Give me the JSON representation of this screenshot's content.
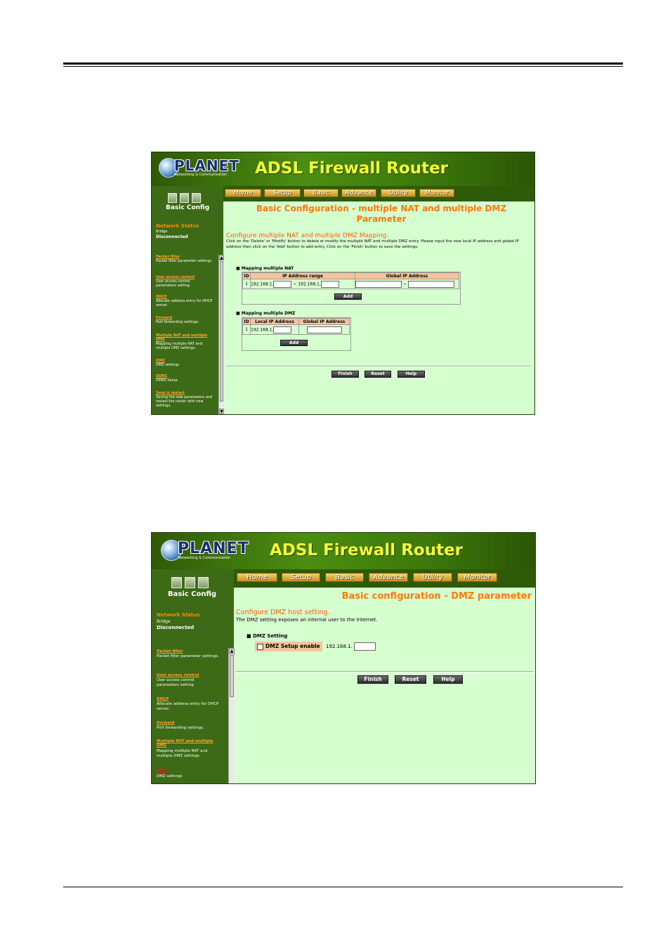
{
  "screen1": {
    "logo": {
      "brand": "PLANET",
      "tagline": "Networking & Communication"
    },
    "title": "ADSL  Firewall Router",
    "nav": [
      "Home",
      "Setup",
      "Basic",
      "Advance",
      "Utility",
      "Monitor"
    ],
    "sidebar": {
      "heading": "Basic Config",
      "network_status_label": "Network Status",
      "mode": "Bridge",
      "status": "Disconnected",
      "items": [
        {
          "label": "Packet filter",
          "desc": "Packet filter parameter settings."
        },
        {
          "label": "User access control",
          "desc": "User access control parameters setting"
        },
        {
          "label": "DHCP",
          "desc": "Allocate address entry for DHCP server."
        },
        {
          "label": "Forward",
          "desc": "Port forwarding settings."
        },
        {
          "label": "Multiple NAT and multiple DMZ",
          "desc": "Mapping multiple NAT and multiple DMZ settings."
        },
        {
          "label": "DMZ",
          "desc": "DMZ settings"
        },
        {
          "label": "DDNS",
          "desc": "DDNS Setup"
        },
        {
          "label": "Save & restart",
          "desc": "Saving the new parameters and restart the router with new settings."
        }
      ]
    },
    "page_title": "Basic Configuration - multiple NAT and multiple DMZ Parameter",
    "section_heading": "Configure multiple NAT and multiple DMZ Mapping.",
    "description": "Click on the 'Delete' or 'Modify' button to delete or modify the multiple NAT and multiple DMZ entry. Please input the new local IP address and global IP address then click on the 'Add' button to add entry. Click on the 'Finish' button to save the settings.",
    "nat": {
      "label": "Mapping multiple NAT",
      "headers": [
        "ID",
        "IP Address range",
        "Global IP Address"
      ],
      "row_id": "1",
      "prefix1": "192.168.1.",
      "tilde": "~",
      "prefix2": "192.168.1.",
      "add": "Add"
    },
    "dmz": {
      "label": "Mapping multiple DMZ",
      "headers": [
        "ID",
        "Local IP Address",
        "Global IP Address"
      ],
      "row_id": "1",
      "prefix": "192.168.1.",
      "add": "Add"
    },
    "buttons": {
      "finish": "Finish",
      "reset": "Reset",
      "help": "Help"
    }
  },
  "screen2": {
    "logo": {
      "brand": "PLANET",
      "tagline": "Networking & Communication"
    },
    "title": "ADSL  Firewall Router",
    "nav": [
      "Home",
      "Setup",
      "Basic",
      "Advance",
      "Utility",
      "Monitor"
    ],
    "sidebar": {
      "heading": "Basic Config",
      "network_status_label": "Network Status",
      "mode": "Bridge",
      "status": "Disconnected",
      "items": [
        {
          "label": "Packet filter",
          "desc": "Packet filter parameter settings."
        },
        {
          "label": "User access control",
          "desc": "User access control parameters setting"
        },
        {
          "label": "DHCP",
          "desc": "Allocate address entry for DHCP server."
        },
        {
          "label": "Forward",
          "desc": "Port forwarding settings."
        },
        {
          "label": "Multiple NAT and multiple DMZ",
          "desc": "Mapping multiple NAT and multiple DMZ settings."
        },
        {
          "label": "DMZ",
          "desc": "DMZ settings"
        }
      ]
    },
    "page_title": "Basic configuration - DMZ parameter",
    "section_heading": "Configure DMZ host setting.",
    "description": "The DMZ setting exposes an internal user to the Internet.",
    "dmz_setting": {
      "label": "DMZ Setting",
      "enable_label": "DMZ Setup enable",
      "prefix": "192.168.1."
    },
    "buttons": {
      "finish": "Finish",
      "reset": "Reset",
      "help": "Help"
    }
  }
}
